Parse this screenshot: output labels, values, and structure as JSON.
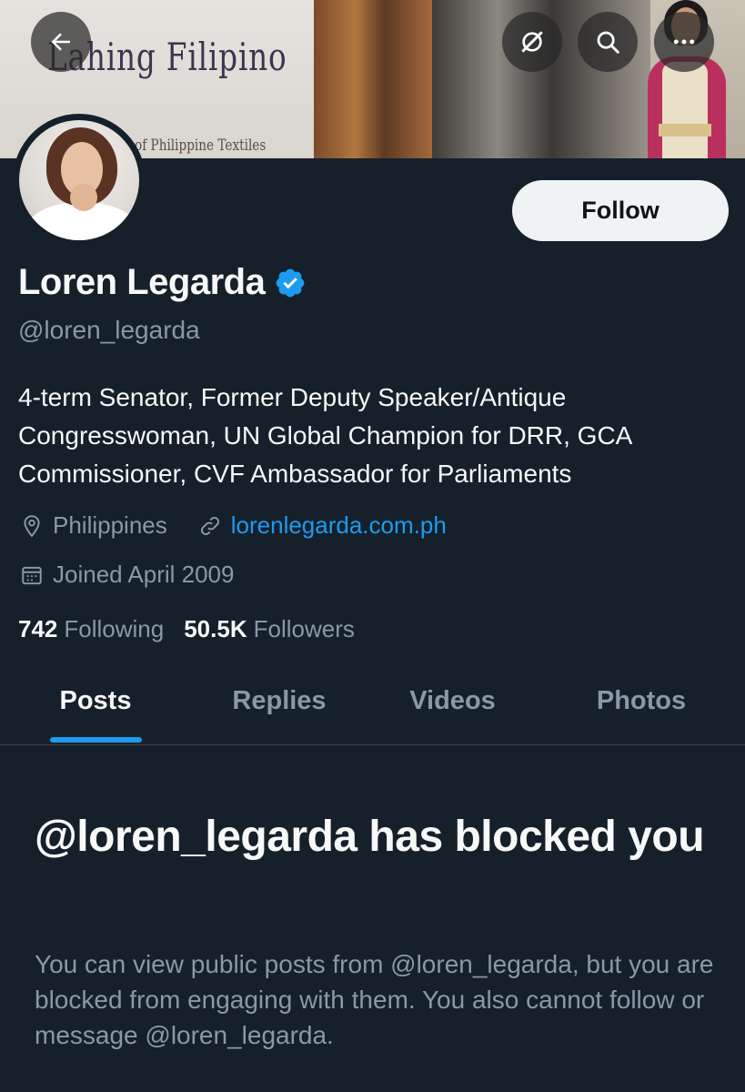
{
  "banner": {
    "title_text": "Lahing Filipino",
    "subtitle_text": "of Philippine Textiles"
  },
  "profile": {
    "display_name": "Loren Legarda",
    "handle": "@loren_legarda",
    "verified": true,
    "follow_label": "Follow",
    "bio": "4-term Senator, Former Deputy Speaker/Antique Congresswoman, UN Global Champion for DRR, GCA Commissioner, CVF Ambassador for Parliaments",
    "location": "Philippines",
    "website": "lorenlegarda.com.ph",
    "joined": "Joined April 2009",
    "following_count": "742",
    "following_label": "Following",
    "followers_count": "50.5K",
    "followers_label": "Followers"
  },
  "tabs": [
    {
      "label": "Posts",
      "active": true
    },
    {
      "label": "Replies",
      "active": false
    },
    {
      "label": "Videos",
      "active": false
    },
    {
      "label": "Photos",
      "active": false
    }
  ],
  "blocked": {
    "title": "@loren_legarda has blocked you",
    "description": "You can view public posts from @loren_legarda, but you are blocked from engaging with them. You also cannot follow or message @loren_legarda."
  },
  "icons": {
    "back": "back-arrow-icon",
    "grok": "grok-icon",
    "search": "search-icon",
    "more": "more-icon",
    "location": "location-pin-icon",
    "link": "link-icon",
    "calendar": "calendar-icon",
    "verified": "verified-badge-icon"
  },
  "colors": {
    "background": "#15202b",
    "accent": "#1d9bf0",
    "secondary_text": "#8b98a5",
    "primary_text": "#f7f9f9"
  }
}
